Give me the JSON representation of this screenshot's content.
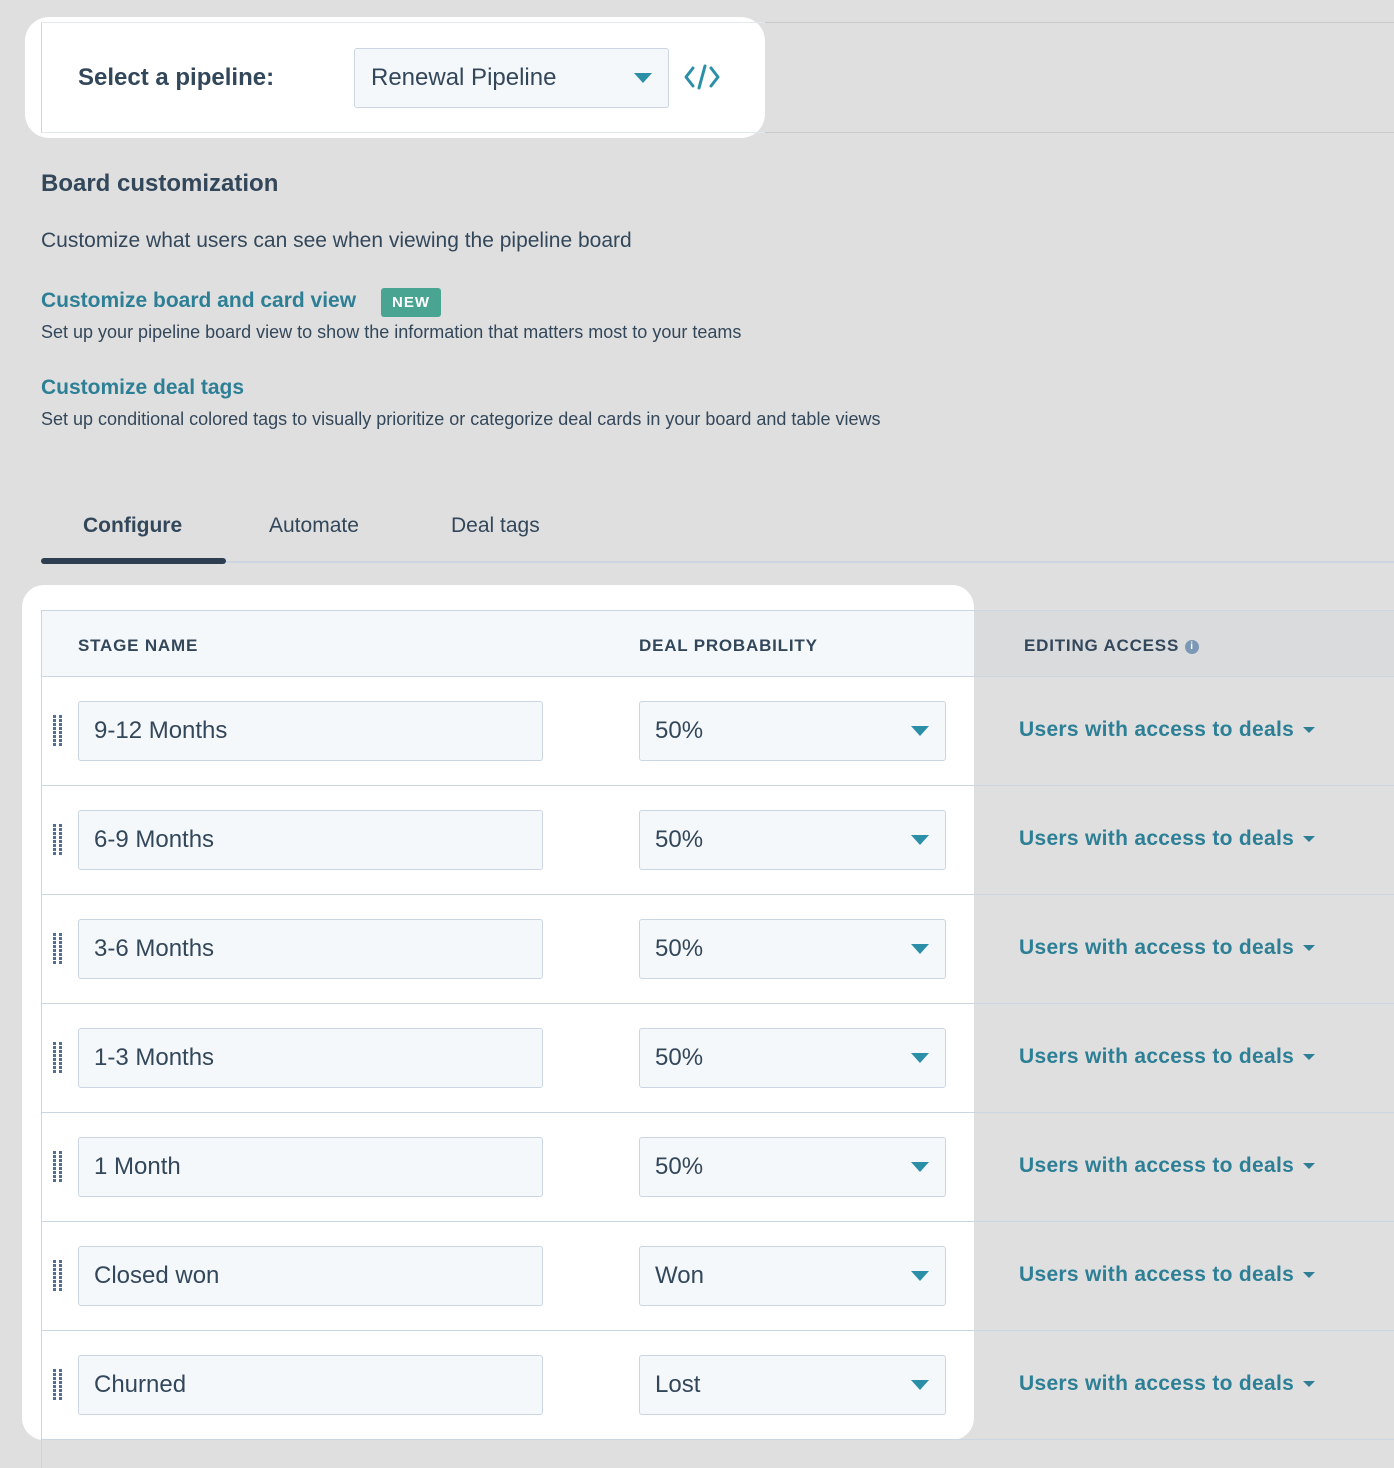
{
  "pipeline": {
    "label": "Select a pipeline:",
    "selected": "Renewal Pipeline",
    "embed_icon": "code-icon"
  },
  "board": {
    "heading": "Board customization",
    "description": "Customize what users can see when viewing the pipeline board",
    "card_view_link": "Customize board and card view",
    "card_view_badge": "NEW",
    "card_view_desc": "Set up your pipeline board view to show the information that matters most to your teams",
    "deal_tags_link": "Customize deal tags",
    "deal_tags_desc": "Set up conditional colored tags to visually prioritize or categorize deal cards in your board and table views"
  },
  "tabs": [
    {
      "label": "Configure",
      "active": true
    },
    {
      "label": "Automate",
      "active": false
    },
    {
      "label": "Deal tags",
      "active": false
    }
  ],
  "table": {
    "headers": {
      "stage_name": "STAGE NAME",
      "deal_probability": "DEAL PROBABILITY",
      "editing_access": "EDITING ACCESS"
    },
    "rows": [
      {
        "stage": "9-12 Months",
        "probability": "50%",
        "access": "Users with access to deals"
      },
      {
        "stage": "6-9 Months",
        "probability": "50%",
        "access": "Users with access to deals"
      },
      {
        "stage": "3-6 Months",
        "probability": "50%",
        "access": "Users with access to deals"
      },
      {
        "stage": "1-3 Months",
        "probability": "50%",
        "access": "Users with access to deals"
      },
      {
        "stage": "1 Month",
        "probability": "50%",
        "access": "Users with access to deals"
      },
      {
        "stage": "Closed won",
        "probability": "Won",
        "access": "Users with access to deals"
      },
      {
        "stage": "Churned",
        "probability": "Lost",
        "access": "Users with access to deals"
      }
    ]
  },
  "colors": {
    "page_bg": "#dfdfdf",
    "text": "#33475b",
    "link": "#2d7f96",
    "badge": "#4aa492",
    "tab_active": "#2d3e50"
  }
}
